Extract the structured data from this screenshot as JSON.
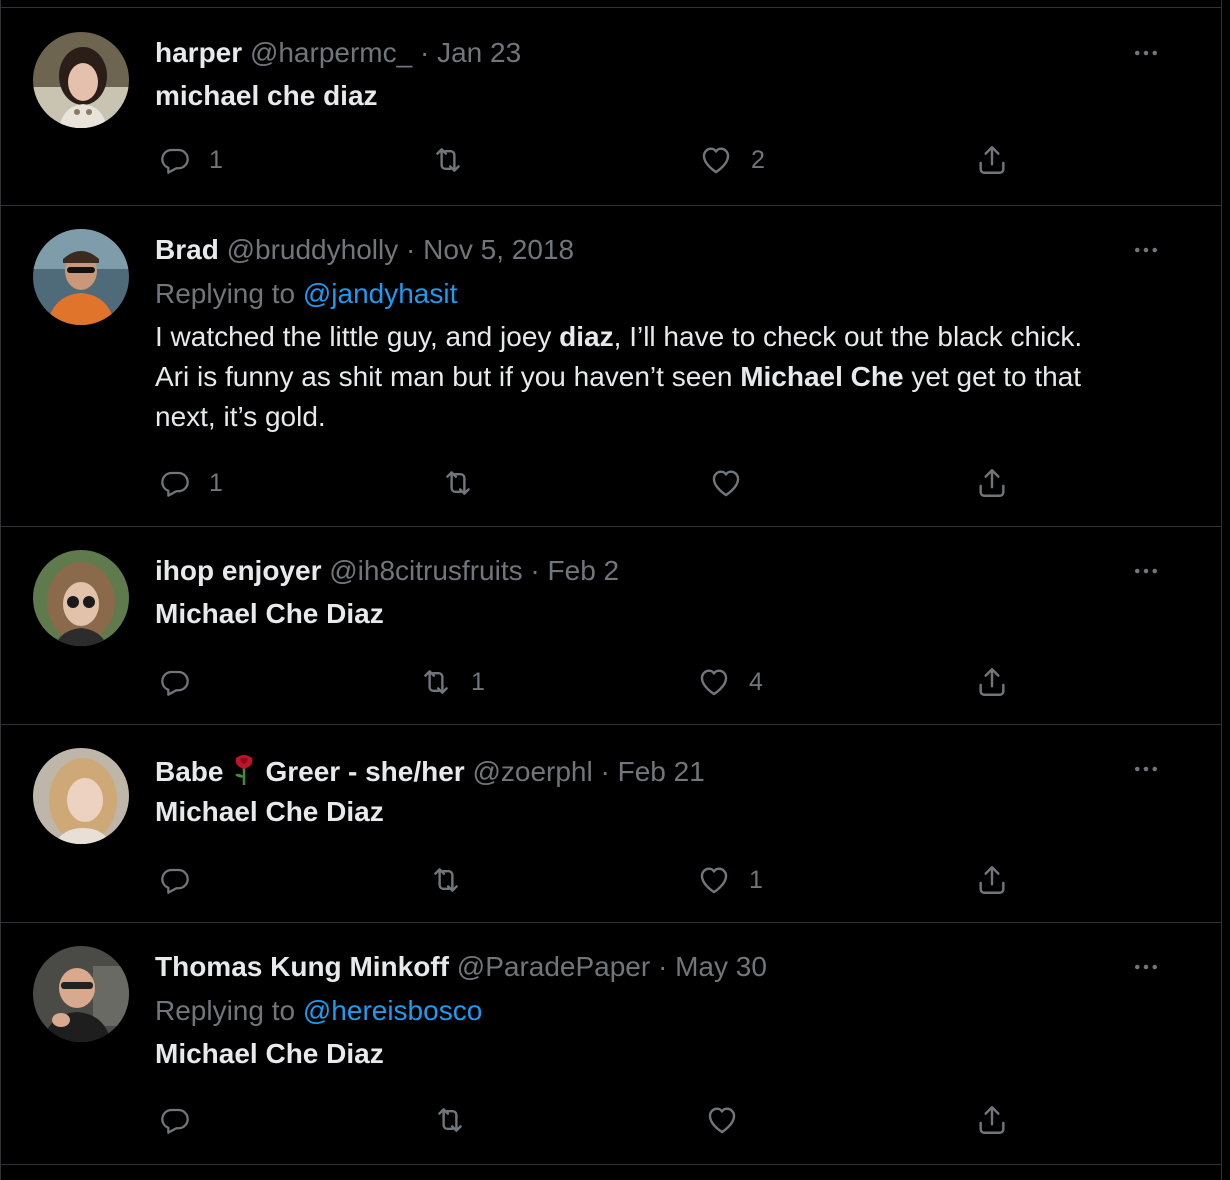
{
  "tweets": [
    {
      "name": "harper",
      "handle": "@harpermc_",
      "separator": "·",
      "date": "Jan 23",
      "body": "michael che diaz",
      "replies": "1",
      "retweets": "",
      "likes": "2",
      "avatar_icon": "avatar-photo"
    },
    {
      "name": "Brad",
      "handle": "@bruddyholly",
      "separator": "·",
      "date": "Nov 5, 2018",
      "replying_prefix": "Replying to",
      "replying_to": "@jandyhasit",
      "body_lines": [
        [
          "I watched the little guy, and joey ",
          "diaz",
          ", I’ll have to check out the black chick."
        ],
        [
          "Ari is funny as shit man but if you haven’t seen ",
          "Michael Che",
          " yet get to that"
        ],
        [
          "next, it’s gold."
        ]
      ],
      "replies": "1",
      "retweets": "",
      "likes": "",
      "avatar_icon": "avatar-photo"
    },
    {
      "name": "ihop enjoyer",
      "handle": "@ih8citrusfruits",
      "separator": "·",
      "date": "Feb 2",
      "body": "Michael Che Diaz",
      "replies": "",
      "retweets": "1",
      "likes": "4",
      "avatar_icon": "avatar-photo"
    },
    {
      "name_part1": "Babe",
      "name_emoji": "rose-icon",
      "name_part2": "Greer - she/her",
      "handle": "@zoerphl",
      "separator": "·",
      "date": "Feb 21",
      "body": "Michael Che Diaz",
      "replies": "",
      "retweets": "",
      "likes": "1",
      "avatar_icon": "avatar-photo"
    },
    {
      "name": "Thomas Kung Minkoff",
      "handle": "@ParadePaper",
      "separator": "·",
      "date": "May 30",
      "replying_prefix": "Replying to",
      "replying_to": "@hereisbosco",
      "body": "Michael Che Diaz",
      "replies": "",
      "retweets": "",
      "likes": "",
      "avatar_icon": "avatar-photo"
    }
  ],
  "colors": {
    "background": "#000000",
    "text": "#e7e9ea",
    "muted": "#71767b",
    "link": "#1d9bf0",
    "divider": "#2f3336"
  },
  "icons": [
    "reply-icon",
    "retweet-icon",
    "like-icon",
    "share-icon",
    "more-icon",
    "rose-icon"
  ]
}
